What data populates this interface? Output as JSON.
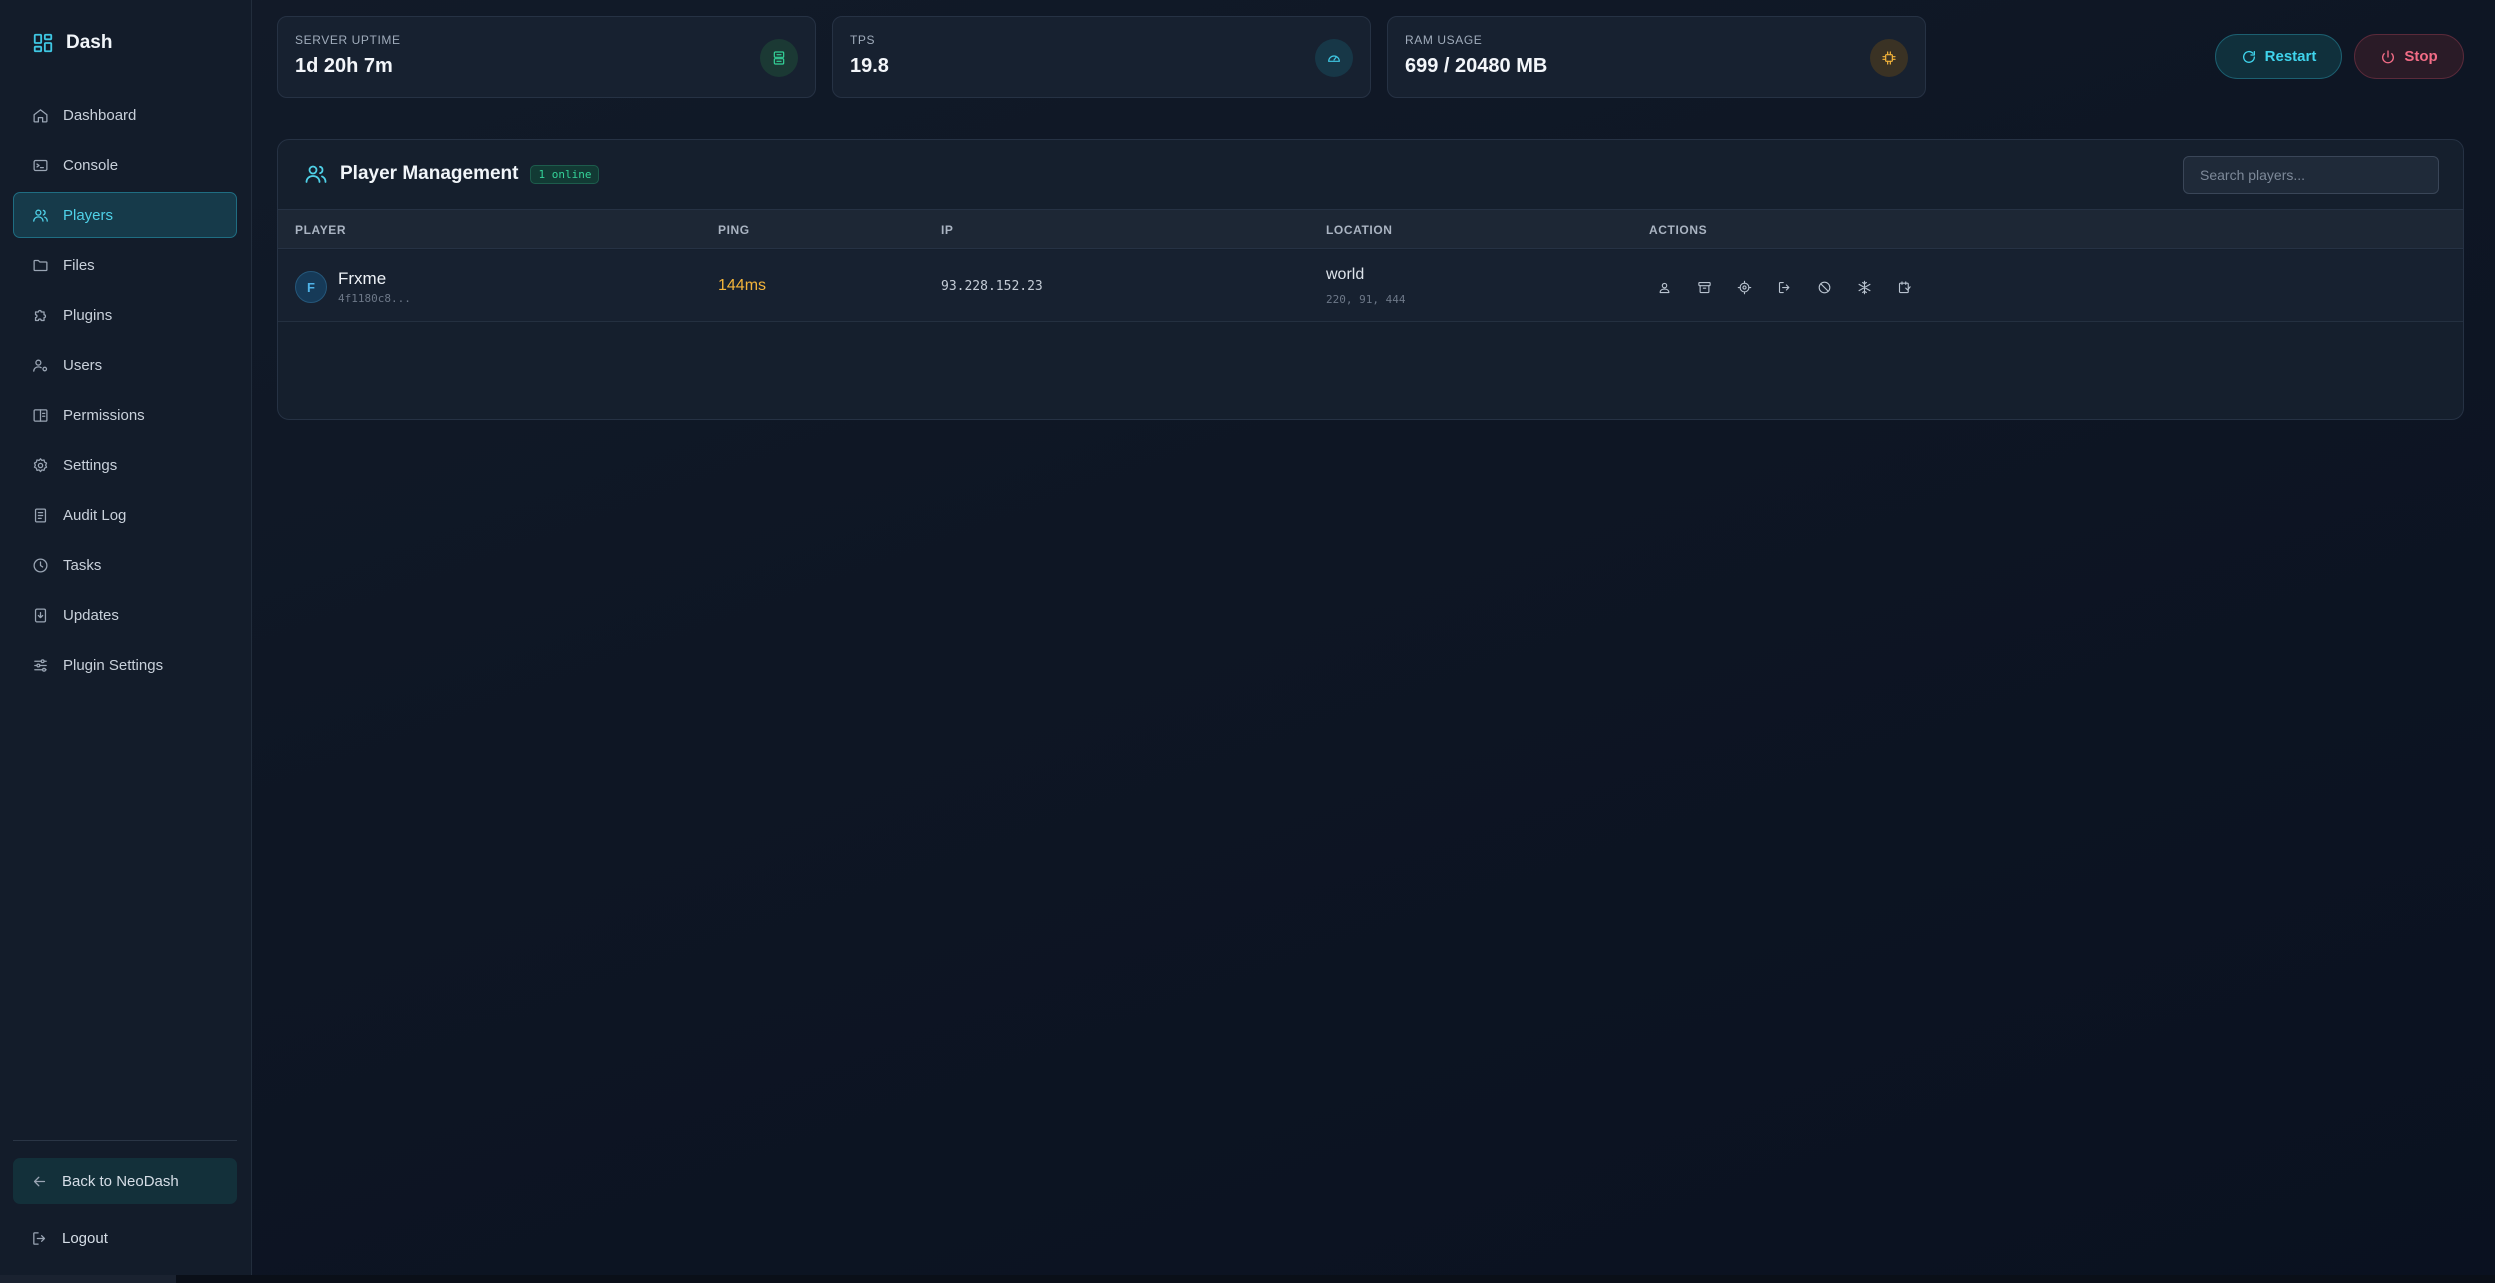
{
  "sidebar": {
    "brand": "Dash",
    "items": [
      {
        "label": "Dashboard",
        "icon": "home-icon"
      },
      {
        "label": "Console",
        "icon": "terminal-icon"
      },
      {
        "label": "Players",
        "icon": "users-icon",
        "active": true
      },
      {
        "label": "Files",
        "icon": "folder-icon"
      },
      {
        "label": "Plugins",
        "icon": "puzzle-icon"
      },
      {
        "label": "Users",
        "icon": "user-cog-icon"
      },
      {
        "label": "Permissions",
        "icon": "book-icon"
      },
      {
        "label": "Settings",
        "icon": "gear-icon"
      },
      {
        "label": "Audit Log",
        "icon": "clipboard-icon"
      },
      {
        "label": "Tasks",
        "icon": "clock-icon"
      },
      {
        "label": "Updates",
        "icon": "download-icon"
      },
      {
        "label": "Plugin Settings",
        "icon": "sliders-icon"
      }
    ],
    "back_label": "Back to NeoDash",
    "logout_label": "Logout"
  },
  "stats": {
    "uptime": {
      "label": "SERVER UPTIME",
      "value": "1d 20h 7m",
      "icon": "server-icon",
      "color": "#34d399"
    },
    "tps": {
      "label": "TPS",
      "value": "19.8",
      "icon": "gauge-icon",
      "color": "#3fc8e4"
    },
    "ram": {
      "label": "RAM USAGE",
      "value": "699 / 20480 MB",
      "icon": "cpu-icon",
      "color": "#f5b53a"
    }
  },
  "controls": {
    "restart_label": "Restart",
    "stop_label": "Stop"
  },
  "players_panel": {
    "title": "Player Management",
    "online_badge": "1 online",
    "search_placeholder": "Search players...",
    "columns": [
      "PLAYER",
      "PING",
      "IP",
      "LOCATION",
      "ACTIONS"
    ],
    "rows": [
      {
        "avatar_letter": "F",
        "name": "Frxme",
        "uuid": "4f1180c8...",
        "ping": "144ms",
        "ip": "93.228.152.23",
        "world": "world",
        "coords": "220, 91, 444"
      }
    ],
    "action_icons": [
      "user-icon",
      "archive-icon",
      "target-icon",
      "kick-icon",
      "ban-icon",
      "freeze-icon",
      "teleport-icon"
    ]
  },
  "colors": {
    "accent": "#4fd1e8",
    "ping_warning": "#f5b53a",
    "danger": "#f26c86",
    "online": "#34d399"
  }
}
